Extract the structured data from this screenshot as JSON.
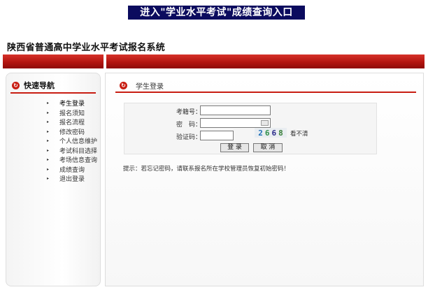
{
  "banner": {
    "text": "进入\"学业水平考试\"成绩查询入口"
  },
  "site": {
    "title": "陕西省普通高中学业水平考试报名系统"
  },
  "sidebar": {
    "title": "快速导航",
    "items": [
      {
        "label": "考生登录"
      },
      {
        "label": "报名须知"
      },
      {
        "label": "报名流程"
      },
      {
        "label": "修改密码"
      },
      {
        "label": "个人信息维护"
      },
      {
        "label": "考试科目选择"
      },
      {
        "label": "考场信息查询"
      },
      {
        "label": "成绩查询"
      },
      {
        "label": "退出登录"
      }
    ]
  },
  "login": {
    "title": "学生登录",
    "exam_number_label": "考籍号：",
    "exam_number_value": "",
    "password_label": "密　码：",
    "password_value": "",
    "captcha_label": "验证码：",
    "captcha_value": "",
    "captcha_digits": [
      "2",
      "6",
      "6",
      "8"
    ],
    "captcha_colors": [
      "#1f6fb8",
      "#2f8f4a",
      "#2a2a8a",
      "#3a7f3a"
    ],
    "refresh_text": "看不清",
    "submit_label": "登 录",
    "cancel_label": "取 消",
    "hint": "提示：若忘记密码，请联系报名所在学校管理员恢复初始密码！"
  },
  "colors": {
    "brand_red": "#c81d12",
    "banner_bg": "#0b0b5e"
  },
  "icons": {
    "nav": "circle-arrow-icon",
    "login": "circle-arrow-icon",
    "keyboard": "keyboard-icon",
    "bullet": "triangle-bullet-icon"
  }
}
